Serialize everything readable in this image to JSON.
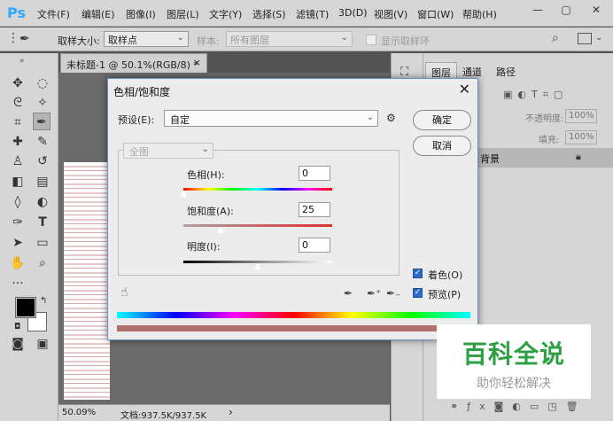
{
  "app": {
    "logo": "Ps",
    "menus": [
      "文件(F)",
      "编辑(E)",
      "图像(I)",
      "图层(L)",
      "文字(Y)",
      "选择(S)",
      "滤镜(T)",
      "3D(D)",
      "视图(V)",
      "窗口(W)",
      "帮助(H)"
    ],
    "window_controls": [
      "—",
      "▢",
      "✕"
    ]
  },
  "options_bar": {
    "sample_size_label": "取样大小:",
    "sample_size_value": "取样点",
    "sample_label": "样本:",
    "sample_value": "所有图层",
    "show_ring_label": "显示取样环"
  },
  "document": {
    "tab_title": "未标题-1 @ 50.1%(RGB/8) *",
    "tab_close": "×",
    "zoom": "50.09%",
    "doc_size": "文档:937.5K/937.5K",
    "status_arrow": "›"
  },
  "layers_panel": {
    "tabs": [
      "图层",
      "通道",
      "路径"
    ],
    "opacity_label": "不透明度:",
    "opacity_value": "100%",
    "fill_label": "填充:",
    "fill_value": "100%",
    "background_layer": "背景"
  },
  "dialog": {
    "title": "色相/饱和度",
    "close": "✕",
    "preset_label": "预设(E):",
    "preset_value": "自定",
    "ok": "确定",
    "cancel": "取消",
    "channel": "全图",
    "hue_label": "色相(H):",
    "hue_value": "0",
    "saturation_label": "饱和度(A):",
    "saturation_value": "25",
    "lightness_label": "明度(I):",
    "lightness_value": "0",
    "colorize_label": "着色(O)",
    "colorize_checked": true,
    "preview_label": "预览(P)",
    "preview_checked": true
  },
  "watermark": {
    "main": "百科全说",
    "sub": "助你轻松解决"
  },
  "colors": {
    "ps_blue": "#31a8ff",
    "dialog_border": "#6a8fc7",
    "checkbox_blue": "#2c6bc5",
    "watermark_green": "#2ea043",
    "tinted_bar": "#b07070"
  }
}
